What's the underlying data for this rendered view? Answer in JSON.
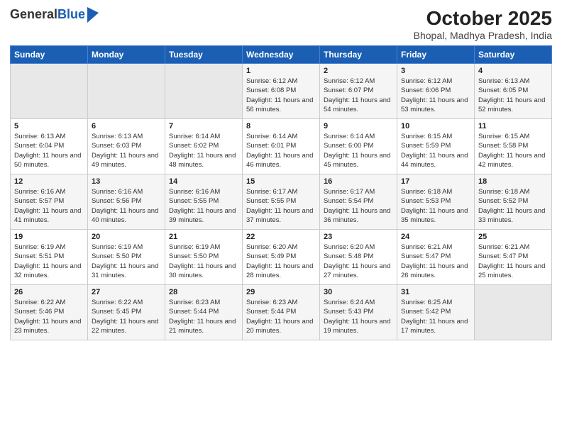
{
  "logo": {
    "general": "General",
    "blue": "Blue"
  },
  "title": "October 2025",
  "subtitle": "Bhopal, Madhya Pradesh, India",
  "days_of_week": [
    "Sunday",
    "Monday",
    "Tuesday",
    "Wednesday",
    "Thursday",
    "Friday",
    "Saturday"
  ],
  "weeks": [
    [
      {
        "day": "",
        "sunrise": "",
        "sunset": "",
        "daylight": ""
      },
      {
        "day": "",
        "sunrise": "",
        "sunset": "",
        "daylight": ""
      },
      {
        "day": "",
        "sunrise": "",
        "sunset": "",
        "daylight": ""
      },
      {
        "day": "1",
        "sunrise": "Sunrise: 6:12 AM",
        "sunset": "Sunset: 6:08 PM",
        "daylight": "Daylight: 11 hours and 56 minutes."
      },
      {
        "day": "2",
        "sunrise": "Sunrise: 6:12 AM",
        "sunset": "Sunset: 6:07 PM",
        "daylight": "Daylight: 11 hours and 54 minutes."
      },
      {
        "day": "3",
        "sunrise": "Sunrise: 6:12 AM",
        "sunset": "Sunset: 6:06 PM",
        "daylight": "Daylight: 11 hours and 53 minutes."
      },
      {
        "day": "4",
        "sunrise": "Sunrise: 6:13 AM",
        "sunset": "Sunset: 6:05 PM",
        "daylight": "Daylight: 11 hours and 52 minutes."
      }
    ],
    [
      {
        "day": "5",
        "sunrise": "Sunrise: 6:13 AM",
        "sunset": "Sunset: 6:04 PM",
        "daylight": "Daylight: 11 hours and 50 minutes."
      },
      {
        "day": "6",
        "sunrise": "Sunrise: 6:13 AM",
        "sunset": "Sunset: 6:03 PM",
        "daylight": "Daylight: 11 hours and 49 minutes."
      },
      {
        "day": "7",
        "sunrise": "Sunrise: 6:14 AM",
        "sunset": "Sunset: 6:02 PM",
        "daylight": "Daylight: 11 hours and 48 minutes."
      },
      {
        "day": "8",
        "sunrise": "Sunrise: 6:14 AM",
        "sunset": "Sunset: 6:01 PM",
        "daylight": "Daylight: 11 hours and 46 minutes."
      },
      {
        "day": "9",
        "sunrise": "Sunrise: 6:14 AM",
        "sunset": "Sunset: 6:00 PM",
        "daylight": "Daylight: 11 hours and 45 minutes."
      },
      {
        "day": "10",
        "sunrise": "Sunrise: 6:15 AM",
        "sunset": "Sunset: 5:59 PM",
        "daylight": "Daylight: 11 hours and 44 minutes."
      },
      {
        "day": "11",
        "sunrise": "Sunrise: 6:15 AM",
        "sunset": "Sunset: 5:58 PM",
        "daylight": "Daylight: 11 hours and 42 minutes."
      }
    ],
    [
      {
        "day": "12",
        "sunrise": "Sunrise: 6:16 AM",
        "sunset": "Sunset: 5:57 PM",
        "daylight": "Daylight: 11 hours and 41 minutes."
      },
      {
        "day": "13",
        "sunrise": "Sunrise: 6:16 AM",
        "sunset": "Sunset: 5:56 PM",
        "daylight": "Daylight: 11 hours and 40 minutes."
      },
      {
        "day": "14",
        "sunrise": "Sunrise: 6:16 AM",
        "sunset": "Sunset: 5:55 PM",
        "daylight": "Daylight: 11 hours and 39 minutes."
      },
      {
        "day": "15",
        "sunrise": "Sunrise: 6:17 AM",
        "sunset": "Sunset: 5:55 PM",
        "daylight": "Daylight: 11 hours and 37 minutes."
      },
      {
        "day": "16",
        "sunrise": "Sunrise: 6:17 AM",
        "sunset": "Sunset: 5:54 PM",
        "daylight": "Daylight: 11 hours and 36 minutes."
      },
      {
        "day": "17",
        "sunrise": "Sunrise: 6:18 AM",
        "sunset": "Sunset: 5:53 PM",
        "daylight": "Daylight: 11 hours and 35 minutes."
      },
      {
        "day": "18",
        "sunrise": "Sunrise: 6:18 AM",
        "sunset": "Sunset: 5:52 PM",
        "daylight": "Daylight: 11 hours and 33 minutes."
      }
    ],
    [
      {
        "day": "19",
        "sunrise": "Sunrise: 6:19 AM",
        "sunset": "Sunset: 5:51 PM",
        "daylight": "Daylight: 11 hours and 32 minutes."
      },
      {
        "day": "20",
        "sunrise": "Sunrise: 6:19 AM",
        "sunset": "Sunset: 5:50 PM",
        "daylight": "Daylight: 11 hours and 31 minutes."
      },
      {
        "day": "21",
        "sunrise": "Sunrise: 6:19 AM",
        "sunset": "Sunset: 5:50 PM",
        "daylight": "Daylight: 11 hours and 30 minutes."
      },
      {
        "day": "22",
        "sunrise": "Sunrise: 6:20 AM",
        "sunset": "Sunset: 5:49 PM",
        "daylight": "Daylight: 11 hours and 28 minutes."
      },
      {
        "day": "23",
        "sunrise": "Sunrise: 6:20 AM",
        "sunset": "Sunset: 5:48 PM",
        "daylight": "Daylight: 11 hours and 27 minutes."
      },
      {
        "day": "24",
        "sunrise": "Sunrise: 6:21 AM",
        "sunset": "Sunset: 5:47 PM",
        "daylight": "Daylight: 11 hours and 26 minutes."
      },
      {
        "day": "25",
        "sunrise": "Sunrise: 6:21 AM",
        "sunset": "Sunset: 5:47 PM",
        "daylight": "Daylight: 11 hours and 25 minutes."
      }
    ],
    [
      {
        "day": "26",
        "sunrise": "Sunrise: 6:22 AM",
        "sunset": "Sunset: 5:46 PM",
        "daylight": "Daylight: 11 hours and 23 minutes."
      },
      {
        "day": "27",
        "sunrise": "Sunrise: 6:22 AM",
        "sunset": "Sunset: 5:45 PM",
        "daylight": "Daylight: 11 hours and 22 minutes."
      },
      {
        "day": "28",
        "sunrise": "Sunrise: 6:23 AM",
        "sunset": "Sunset: 5:44 PM",
        "daylight": "Daylight: 11 hours and 21 minutes."
      },
      {
        "day": "29",
        "sunrise": "Sunrise: 6:23 AM",
        "sunset": "Sunset: 5:44 PM",
        "daylight": "Daylight: 11 hours and 20 minutes."
      },
      {
        "day": "30",
        "sunrise": "Sunrise: 6:24 AM",
        "sunset": "Sunset: 5:43 PM",
        "daylight": "Daylight: 11 hours and 19 minutes."
      },
      {
        "day": "31",
        "sunrise": "Sunrise: 6:25 AM",
        "sunset": "Sunset: 5:42 PM",
        "daylight": "Daylight: 11 hours and 17 minutes."
      },
      {
        "day": "",
        "sunrise": "",
        "sunset": "",
        "daylight": ""
      }
    ]
  ]
}
